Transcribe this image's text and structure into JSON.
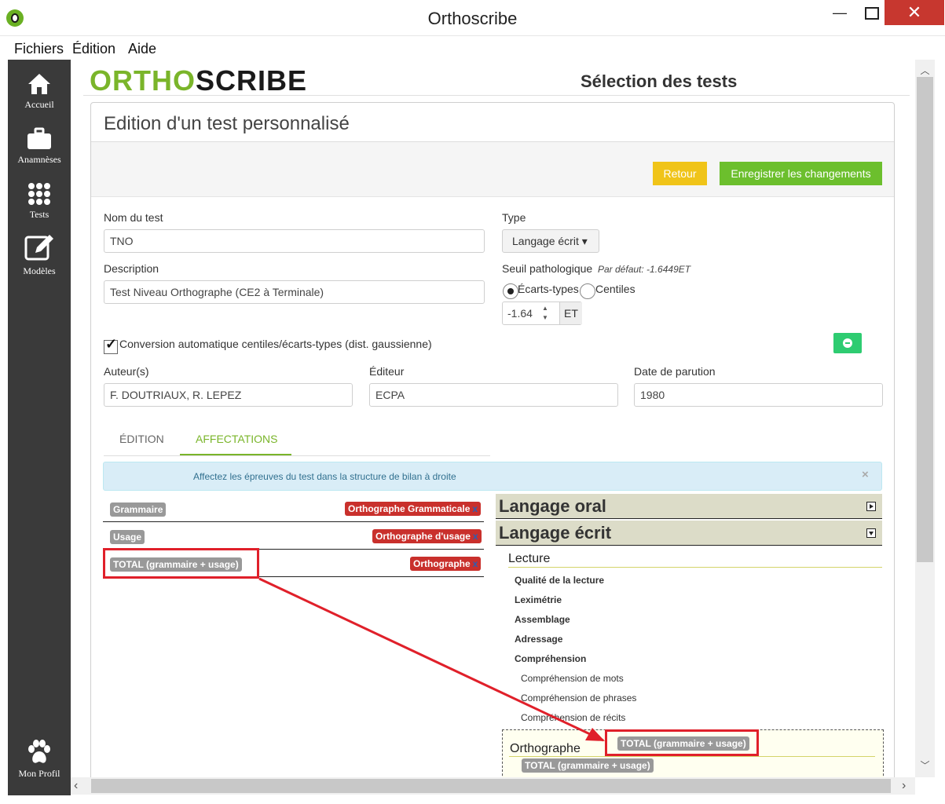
{
  "window": {
    "title": "Orthoscribe",
    "minimize": "—",
    "close": "✕"
  },
  "menu": {
    "items": [
      "Fichiers",
      "Édition",
      "Aide"
    ]
  },
  "sidebar": {
    "items": [
      {
        "label": "Accueil",
        "icon": "home-icon"
      },
      {
        "label": "Anamnèses",
        "icon": "briefcase-icon"
      },
      {
        "label": "Tests",
        "icon": "grid-icon"
      },
      {
        "label": "Modèles",
        "icon": "edit-icon"
      }
    ],
    "profile": {
      "label": "Mon Profil",
      "icon": "paw-icon"
    }
  },
  "header": {
    "logo_part1": "ORTHO",
    "logo_part2": "SCRIBE",
    "page_title": "Sélection des tests",
    "colors": {
      "logo_green": "#7ab52a",
      "logo_dark": "#1a1a1a"
    }
  },
  "panel": {
    "title": "Edition d'un test personnalisé",
    "buttons": {
      "back": "Retour",
      "save": "Enregistrer les changements"
    },
    "colors": {
      "back": "#f0c419",
      "save": "#6cbf2d"
    }
  },
  "form": {
    "name_label": "Nom du test",
    "name_value": "TNO",
    "description_label": "Description",
    "description_value": "Test Niveau Orthographe (CE2 à Terminale)",
    "type_label": "Type",
    "type_value": "Langage écrit ▾",
    "threshold_label": "Seuil pathologique",
    "threshold_default": "Par défaut: -1.6449ET",
    "radio_std": "Écarts-types",
    "radio_centiles": "Centiles",
    "selected_radio": "Écarts-types",
    "threshold_value": "-1.64",
    "threshold_unit": "ET",
    "conversion_label": "Conversion automatique centiles/écarts-types (dist. gaussienne)",
    "conversion_checked": true,
    "check_mark": "✓",
    "authors_label": "Auteur(s)",
    "authors_value": "F. DOUTRIAUX, R. LEPEZ",
    "publisher_label": "Éditeur",
    "publisher_value": "ECPA",
    "date_label": "Date de parution",
    "date_value": "1980"
  },
  "tabs": {
    "items": [
      "ÉDITION",
      "AFFECTATIONS"
    ],
    "active": "AFFECTATIONS"
  },
  "alert": {
    "text": "Affectez les épreuves du test dans la structure de bilan à droite",
    "close": "×"
  },
  "assignments": [
    {
      "epreuve": "Grammaire",
      "target": "Orthographe Grammaticale",
      "remove": "x"
    },
    {
      "epreuve": "Usage",
      "target": "Orthographe d'usage",
      "remove": "x"
    },
    {
      "epreuve": "TOTAL (grammaire + usage)",
      "target": "Orthographe",
      "remove": "x"
    }
  ],
  "structure": {
    "categories": [
      {
        "label": "Langage oral",
        "expanded": false
      },
      {
        "label": "Langage écrit",
        "expanded": true
      }
    ],
    "lecture": {
      "label": "Lecture",
      "items": [
        "Qualité de la lecture",
        "Leximétrie",
        "Assemblage",
        "Adressage",
        "Compréhension"
      ],
      "subitems": [
        "Compréhension de mots",
        "Compréhension de phrases",
        "Compréhension de récits"
      ]
    },
    "orthographe": {
      "label": "Orthographe",
      "dragged_tag": "TOTAL (grammaire + usage)",
      "dropped_tag": "TOTAL (grammaire + usage)"
    }
  },
  "annotation_color": "#e0202a"
}
